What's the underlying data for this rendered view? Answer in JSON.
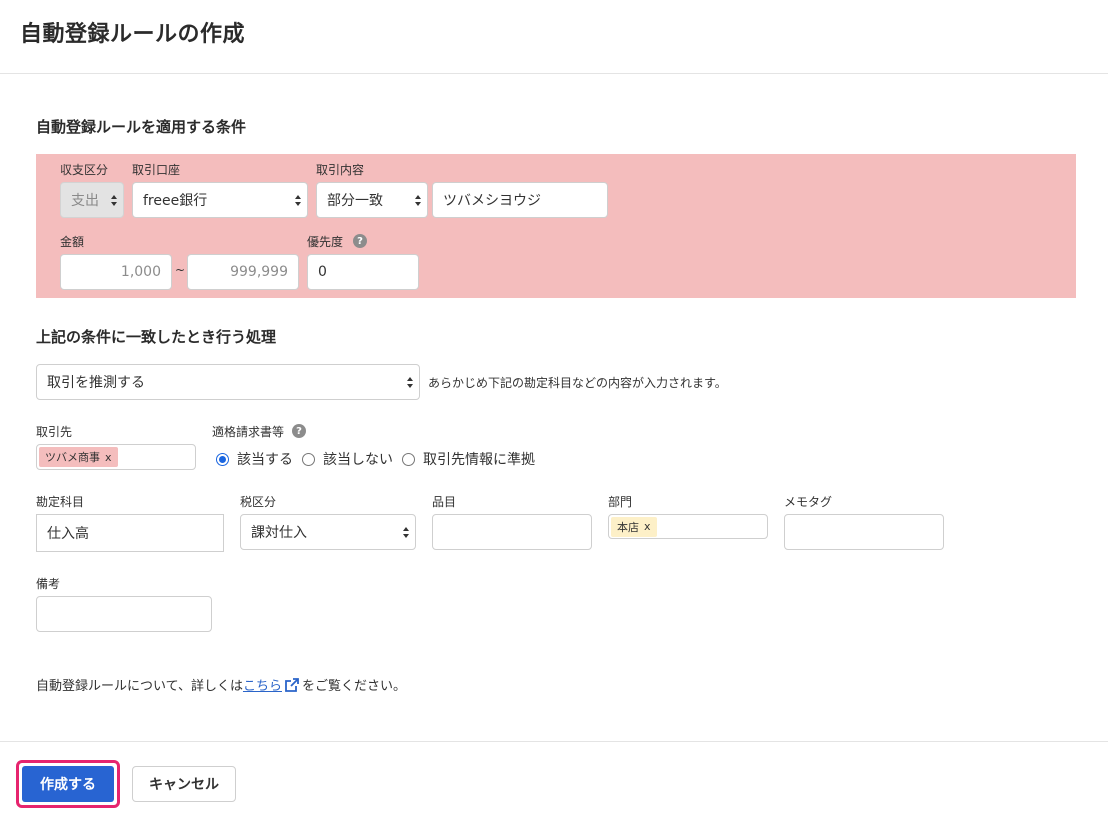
{
  "page": {
    "title": "自動登録ルールの作成"
  },
  "conditions": {
    "section_title": "自動登録ルールを適用する条件",
    "income_type": {
      "label": "収支区分",
      "value": "支出"
    },
    "account": {
      "label": "取引口座",
      "value": "freee銀行"
    },
    "description": {
      "label": "取引内容",
      "match_type": "部分一致",
      "value": "ツバメシヨウジ"
    },
    "amount": {
      "label": "金額",
      "min": "1,000",
      "separator": "~",
      "max": "999,999"
    },
    "priority": {
      "label": "優先度",
      "help_icon": "?",
      "value": "0"
    }
  },
  "action": {
    "section_title": "上記の条件に一致したとき行う処理",
    "process": {
      "value": "取引を推測する",
      "hint": "あらかじめ下記の勘定科目などの内容が入力されます。"
    },
    "partner": {
      "label": "取引先",
      "tag": "ツバメ商事",
      "tag_remove": "x"
    },
    "invoice": {
      "label": "適格請求書等",
      "help_icon": "?",
      "options": [
        "該当する",
        "該当しない",
        "取引先情報に準拠"
      ],
      "selected": "該当する"
    },
    "account_item": {
      "label": "勘定科目",
      "value": "仕入高"
    },
    "tax": {
      "label": "税区分",
      "value": "課対仕入"
    },
    "item": {
      "label": "品目",
      "value": ""
    },
    "section": {
      "label": "部門",
      "tag": "本店",
      "tag_remove": "x"
    },
    "memo_tag": {
      "label": "メモタグ",
      "value": ""
    },
    "note": {
      "label": "備考",
      "value": ""
    }
  },
  "info": {
    "prefix": "自動登録ルールについて、詳しくは",
    "link": "こちら",
    "suffix": "をご覧ください。"
  },
  "footer": {
    "create_label": "作成する",
    "cancel_label": "キャンセル"
  },
  "colors": {
    "condition_bg": "#f4bdbd",
    "primary": "#2864d2",
    "highlight": "#e6246e",
    "link": "#2a64c9"
  }
}
